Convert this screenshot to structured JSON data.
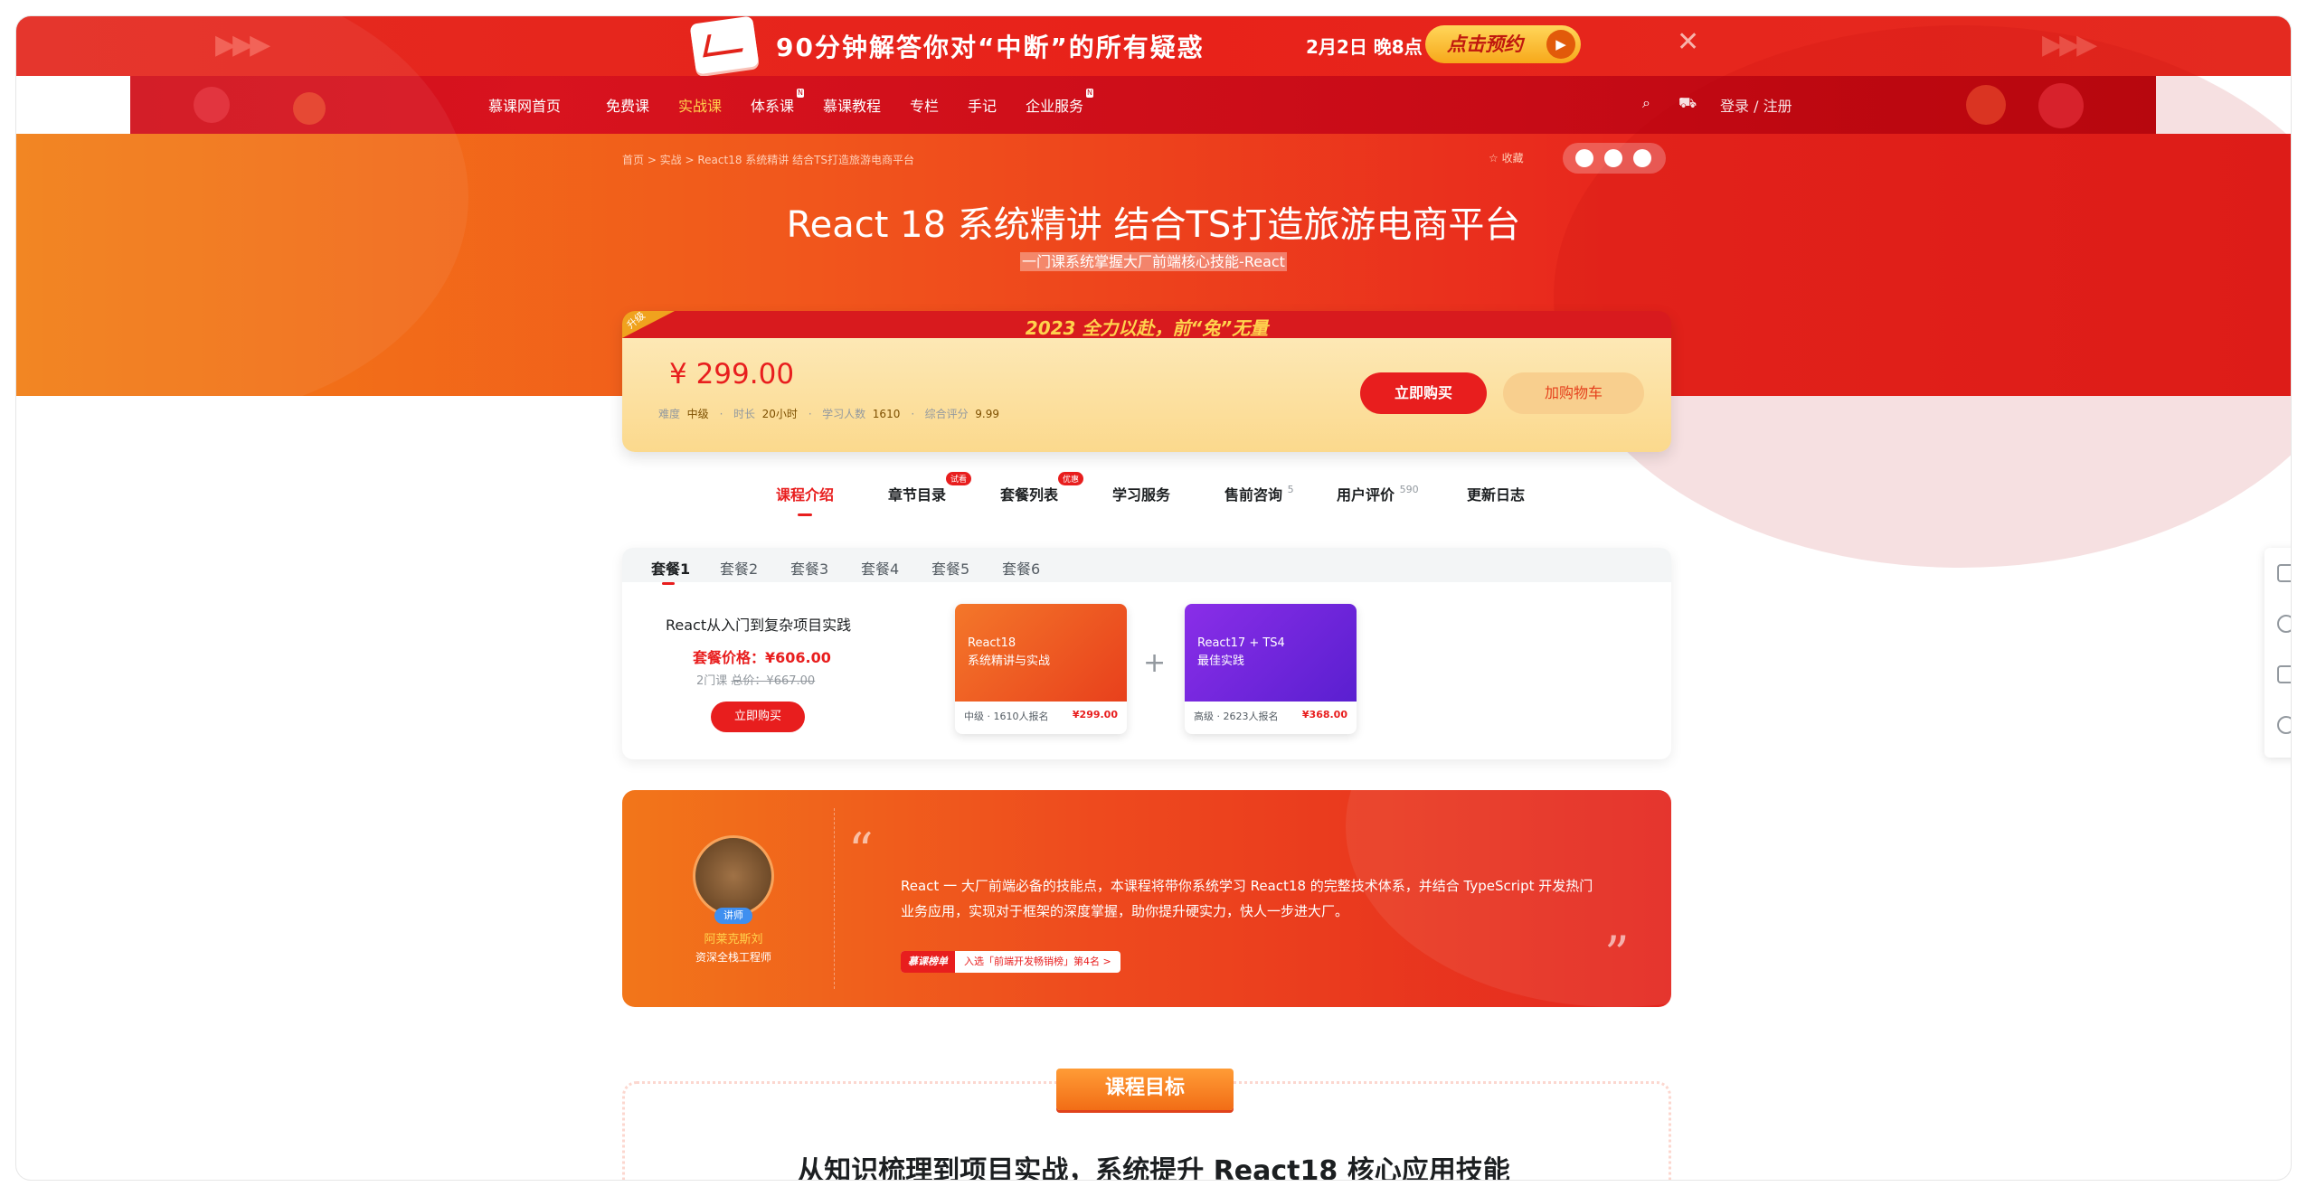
{
  "promo": {
    "title": "90分钟解答你对“中断”的所有疑惑",
    "date": "2月2日 晚8点",
    "cta": "点击预约"
  },
  "nav": {
    "items": [
      {
        "label": "慕课网首页"
      },
      {
        "label": "免费课"
      },
      {
        "label": "实战课",
        "active": true
      },
      {
        "label": "体系课",
        "new": true
      },
      {
        "label": "慕课教程"
      },
      {
        "label": "专栏"
      },
      {
        "label": "手记"
      },
      {
        "label": "企业服务",
        "new": true
      }
    ],
    "login": "登录 / 注册"
  },
  "breadcrumb": "首页 > 实战 > React18 系统精讲 结合TS打造旅游电商平台",
  "favorite": "收藏",
  "course": {
    "title": "React 18 系统精讲 结合TS打造旅游电商平台",
    "subtitle": "一门课系统掌握大厂前端核心技能-React"
  },
  "price_card": {
    "banner": "2023 全力以赴，前“兔”无量",
    "tag": "升级",
    "price": "¥ 299.00",
    "meta": {
      "difficulty_label": "难度",
      "difficulty": "中级",
      "duration_label": "时长",
      "duration": "20小时",
      "learners_label": "学习人数",
      "learners": "1610",
      "rating_label": "综合评分",
      "rating": "9.99"
    },
    "buy": "立即购买",
    "cart": "加购物车"
  },
  "tabs": [
    {
      "label": "课程介绍",
      "active": true
    },
    {
      "label": "章节目录",
      "badge": "试看"
    },
    {
      "label": "套餐列表",
      "badge": "优惠"
    },
    {
      "label": "学习服务"
    },
    {
      "label": "售前咨询",
      "sup": "5"
    },
    {
      "label": "用户评价",
      "sup": "590"
    },
    {
      "label": "更新日志"
    }
  ],
  "packages": {
    "tabs": [
      "套餐1",
      "套餐2",
      "套餐3",
      "套餐4",
      "套餐5",
      "套餐6"
    ],
    "active": 0,
    "name": "React从入门到复杂项目实践",
    "price": "套餐价格：¥606.00",
    "count": "2门课",
    "original": "总价：¥667.00",
    "buy": "立即购买",
    "courses": [
      {
        "cover_title": "React18\n系统精讲与实战",
        "level": "中级",
        "enrolled": "1610人报名",
        "price": "¥299.00",
        "color": "#f0582a"
      },
      {
        "cover_title": "React17 + TS4\n最佳实践",
        "level": "高级",
        "enrolled": "2623人报名",
        "price": "¥368.00",
        "color": "#7a2ee0"
      }
    ]
  },
  "teacher": {
    "role": "讲师",
    "name": "阿莱克斯刘",
    "title": "资深全栈工程师",
    "description": "React 一 大厂前端必备的技能点，本课程将带你系统学习 React18 的完整技术体系，并结合 TypeScript 开发热门业务应用，实现对于框架的深度掌握，助你提升硬实力，快人一步进大厂。",
    "rank_label": "慕课榜单",
    "rank": "入选「前端开发畅销榜」第4名 >"
  },
  "goal": {
    "tag": "课程目标",
    "title": "从知识梳理到项目实战，系统提升 React18 核心应用技能"
  }
}
